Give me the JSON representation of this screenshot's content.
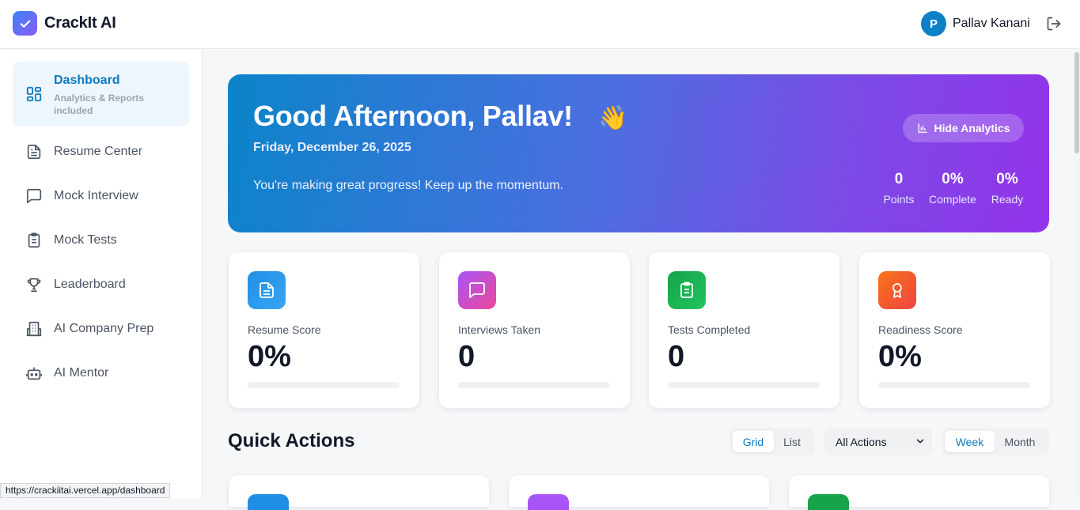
{
  "header": {
    "brand": "CrackIt AI",
    "user_initial": "P",
    "user_name": "Pallav Kanani"
  },
  "sidebar": {
    "items": [
      {
        "label": "Dashboard",
        "sub": "Analytics & Reports included",
        "icon": "dashboard-icon",
        "active": true
      },
      {
        "label": "Resume Center",
        "icon": "document-icon"
      },
      {
        "label": "Mock Interview",
        "icon": "chat-icon"
      },
      {
        "label": "Mock Tests",
        "icon": "clipboard-icon"
      },
      {
        "label": "Leaderboard",
        "icon": "trophy-icon"
      },
      {
        "label": "AI Company Prep",
        "icon": "building-icon"
      },
      {
        "label": "AI Mentor",
        "icon": "robot-icon"
      }
    ]
  },
  "hero": {
    "greeting": "Good Afternoon, Pallav!",
    "emoji": "👋",
    "date": "Friday, December 26, 2025",
    "message": "You're making great progress! Keep up the momentum.",
    "hide_button": "Hide Analytics",
    "stats": [
      {
        "value": "0",
        "label": "Points"
      },
      {
        "value": "0%",
        "label": "Complete"
      },
      {
        "value": "0%",
        "label": "Ready"
      }
    ]
  },
  "cards": [
    {
      "label": "Resume Score",
      "value": "0%",
      "icon": "document-icon",
      "color_from": "#1f8fe6",
      "color_to": "#3aa6f2",
      "progress": 0
    },
    {
      "label": "Interviews Taken",
      "value": "0",
      "icon": "chat-icon",
      "color_from": "#a855f7",
      "color_to": "#ec4899",
      "progress": 0
    },
    {
      "label": "Tests Completed",
      "value": "0",
      "icon": "clipboard-icon",
      "color_from": "#16a34a",
      "color_to": "#22c55e",
      "progress": 0
    },
    {
      "label": "Readiness Score",
      "value": "0%",
      "icon": "award-icon",
      "color_from": "#f97316",
      "color_to": "#ef4444",
      "progress": 0
    }
  ],
  "quick_actions": {
    "title": "Quick Actions",
    "view_toggle": [
      "Grid",
      "List"
    ],
    "view_selected": "Grid",
    "filter_value": "All Actions",
    "period_toggle": [
      "Week",
      "Month"
    ],
    "period_selected": "Week"
  },
  "status_url": "https://crackiitai.vercel.app/dashboard"
}
